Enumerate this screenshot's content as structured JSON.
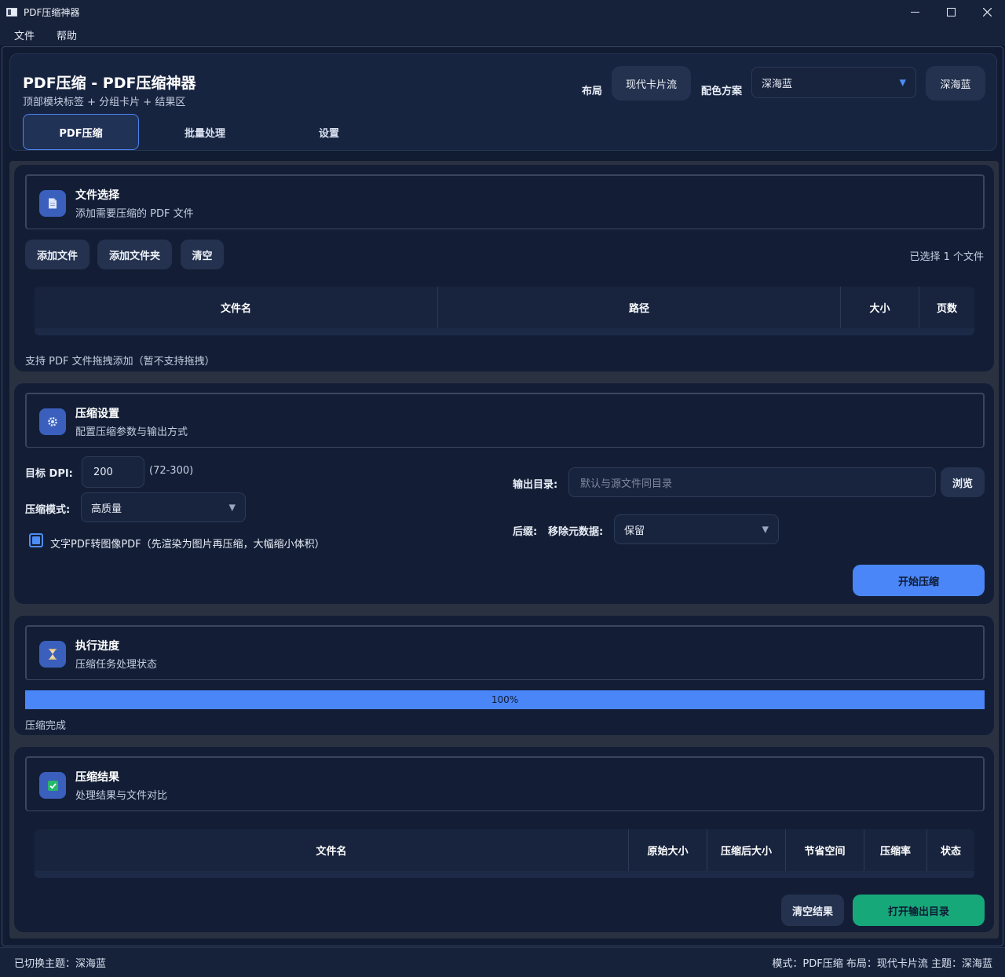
{
  "window": {
    "title": "PDF压缩神器"
  },
  "menubar": {
    "file": "文件",
    "help": "帮助"
  },
  "header": {
    "title": "PDF压缩 - PDF压缩神器",
    "subtitle": "顶部模块标签 + 分组卡片 + 结果区",
    "layout_label": "布局",
    "layout_value": "现代卡片流",
    "scheme_label": "配色方案",
    "scheme_value": "深海蓝",
    "theme_button": "深海蓝",
    "tabs": [
      "PDF压缩",
      "批量处理",
      "设置"
    ]
  },
  "file_card": {
    "title": "文件选择",
    "subtitle": "添加需要压缩的 PDF 文件",
    "add_file": "添加文件",
    "add_folder": "添加文件夹",
    "clear": "清空",
    "selected_count": "已选择 1 个文件",
    "columns": [
      "文件名",
      "路径",
      "大小",
      "页数"
    ],
    "drag_hint": "支持 PDF 文件拖拽添加（暂不支持拖拽）"
  },
  "settings_card": {
    "title": "压缩设置",
    "subtitle": "配置压缩参数与输出方式",
    "dpi_label": "目标 DPI:",
    "dpi_value": "200",
    "dpi_range": "(72-300)",
    "mode_label": "压缩模式:",
    "mode_value": "高质量",
    "convert_label": "文字PDF转图像PDF（先渲染为图片再压缩，大幅缩小体积）",
    "convert_checked": true,
    "output_label": "输出目录:",
    "output_placeholder": "默认与源文件同目录",
    "browse": "浏览",
    "suffix_label": "后缀:",
    "metadata_label": "移除元数据:",
    "metadata_value": "保留",
    "start": "开始压缩"
  },
  "progress_card": {
    "title": "执行进度",
    "subtitle": "压缩任务处理状态",
    "progress": 1.0,
    "progress_text": "100%",
    "status": "压缩完成"
  },
  "result_card": {
    "title": "压缩结果",
    "subtitle": "处理结果与文件对比",
    "columns": [
      "文件名",
      "原始大小",
      "压缩后大小",
      "节省空间",
      "压缩率",
      "状态"
    ],
    "clear_results": "清空结果",
    "open_output": "打开输出目录"
  },
  "statusbar": {
    "left": "已切换主题：深海蓝",
    "right": "模式：PDF压缩   布局：现代卡片流   主题：深海蓝"
  },
  "colors": {
    "accent": "#4a86f7",
    "success": "#17a87a",
    "background": "#0f1a30"
  }
}
